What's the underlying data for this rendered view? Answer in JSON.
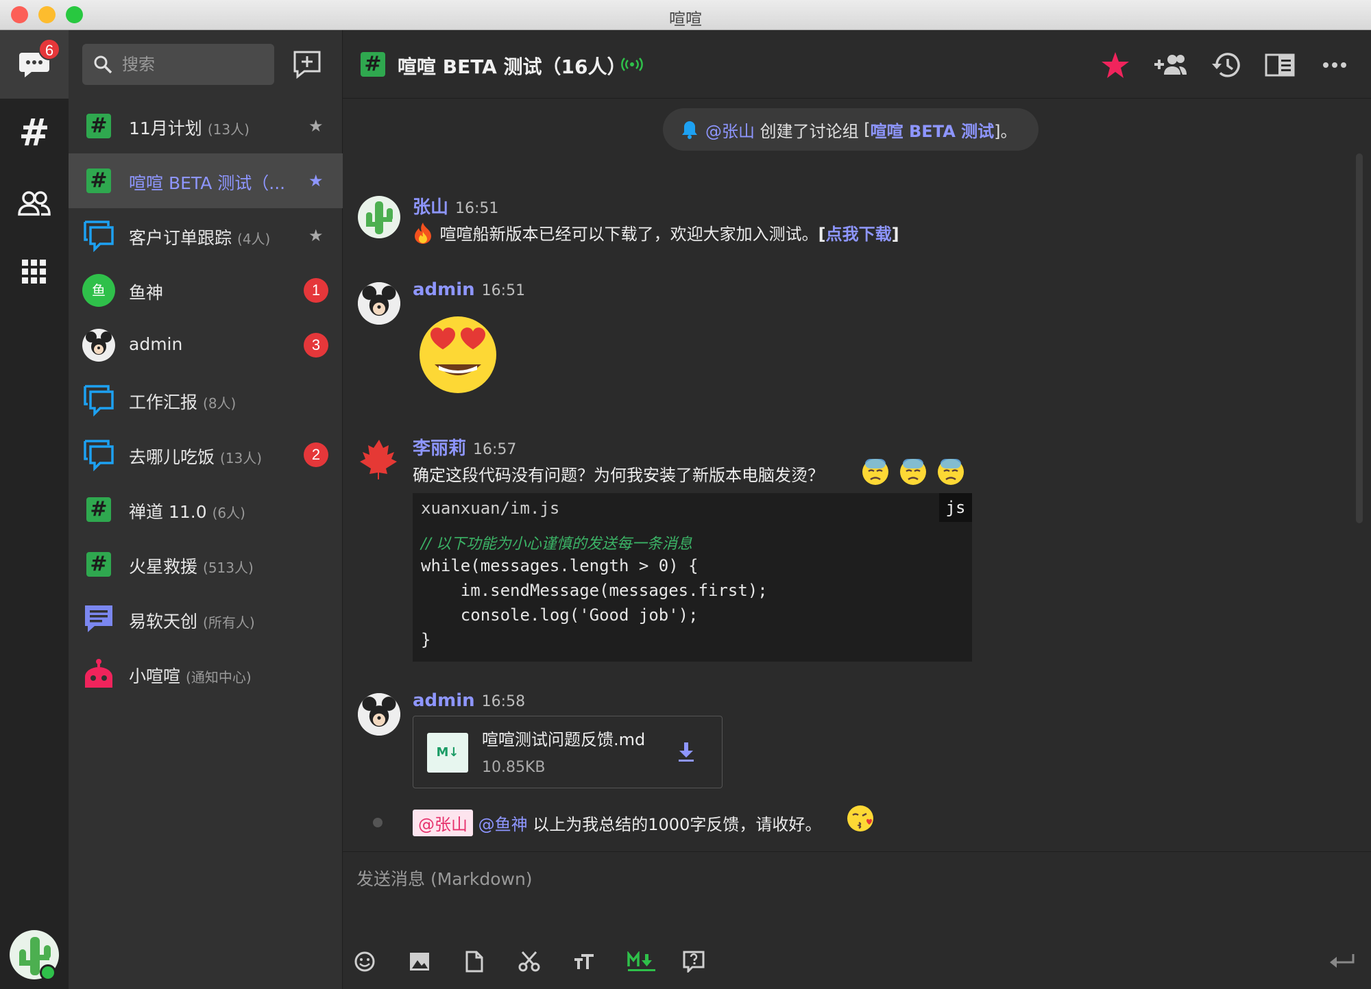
{
  "window": {
    "title": "喧喧"
  },
  "rail": {
    "chat_badge": "6",
    "tabs": [
      "chats",
      "channels",
      "contacts",
      "apps"
    ]
  },
  "sidebar": {
    "search_placeholder": "搜索",
    "items": [
      {
        "name": "11月计划",
        "count": "(13人)",
        "type": "channel",
        "starred": true,
        "active": false
      },
      {
        "name": "喧喧 BETA 测试（...",
        "count": "",
        "type": "channel",
        "starred": true,
        "active": true
      },
      {
        "name": "客户订单跟踪",
        "count": "(4人)",
        "type": "group",
        "starred": true,
        "active": false
      },
      {
        "name": "鱼神",
        "count": "",
        "type": "user-green",
        "avatar_text": "鱼",
        "badge": "1"
      },
      {
        "name": "admin",
        "count": "",
        "type": "user-admin",
        "badge": "3"
      },
      {
        "name": "工作汇报",
        "count": "(8人)",
        "type": "group"
      },
      {
        "name": "去哪儿吃饭",
        "count": "(13人)",
        "type": "group",
        "badge": "2"
      },
      {
        "name": "禅道 11.0",
        "count": "(6人)",
        "type": "channel"
      },
      {
        "name": "火星救援",
        "count": "(513人)",
        "type": "channel"
      },
      {
        "name": "易软天创",
        "count": "(所有人)",
        "type": "system"
      },
      {
        "name": "小喧喧",
        "count": "(通知中心)",
        "type": "robot"
      }
    ]
  },
  "header": {
    "title": "喧喧 BETA 测试（16人）",
    "accent": "#8e96ff",
    "star_color": "#f0245c"
  },
  "notice": {
    "mention": "@张山",
    "text": " 创建了讨论组 ",
    "group_open": "[",
    "group": "喧喧 BETA 测试",
    "group_close": "]。"
  },
  "messages": [
    {
      "sender": "张山",
      "time": "16:51",
      "text": " 喧喧船新版本已经可以下载了，欢迎大家加入测试。",
      "link_open": "[",
      "link": "点我下载",
      "link_close": "]"
    },
    {
      "sender": "admin",
      "time": "16:51",
      "emoji": "star-struck-emoji"
    },
    {
      "sender": "李丽莉",
      "time": "16:57",
      "text": "确定这段代码没有问题？为何我安装了新版本电脑发烫？",
      "code": {
        "file": "xuanxuan/im.js",
        "lang": "js",
        "lines": [
          "// 以下功能为小心谨慎的发送每一条消息",
          "while(messages.length > 0) {",
          "    im.sendMessage(messages.first);",
          "    console.log('Good job');",
          "}"
        ]
      }
    },
    {
      "sender": "admin",
      "time": "16:58",
      "file": {
        "name": "喧喧测试问题反馈.md",
        "size": "10.85KB",
        "icon_text": "M↓"
      },
      "followup": {
        "tag": "@张山",
        "mention": "@鱼神",
        "text": " 以上为我总结的1000字反馈，请收好。"
      }
    }
  ],
  "composer": {
    "placeholder": "发送消息 (Markdown)"
  }
}
